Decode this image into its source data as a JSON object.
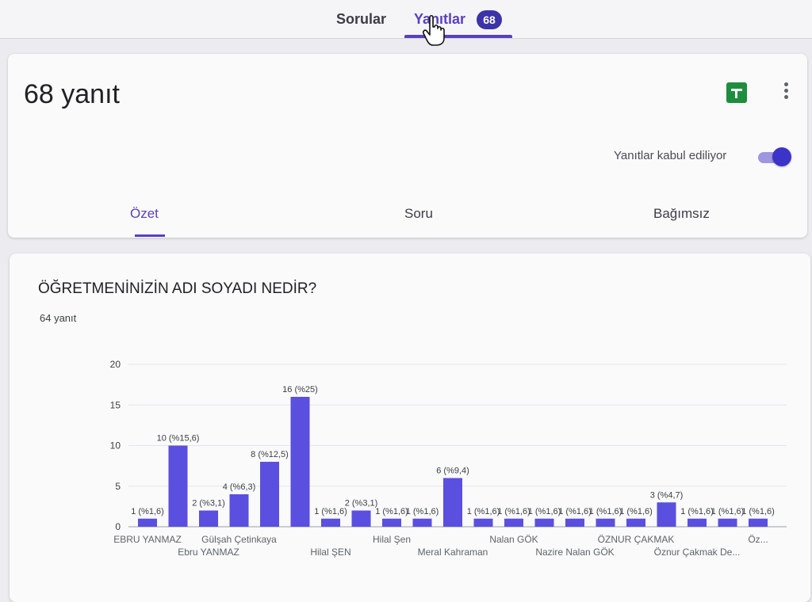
{
  "top_tabs": {
    "questions": "Sorular",
    "responses": "Yanıtlar",
    "responses_badge": "68"
  },
  "header": {
    "title": "68 yanıt",
    "accepting_label": "Yanıtlar kabul ediliyor",
    "accepting_on": true,
    "sheets_icon": "sheets-icon",
    "more_icon": "more-vert-icon"
  },
  "sub_tabs": {
    "summary": "Özet",
    "question": "Soru",
    "individual": "Bağımsız"
  },
  "question": {
    "title": "ÖĞRETMENİNİZİN ADI SOYADI NEDİR?",
    "response_count": "64 yanıt"
  },
  "colors": {
    "accent": "#5a3fc0",
    "bar": "#5b4fe0",
    "toggle": "#3c33c8",
    "sheets": "#1e8e3e"
  },
  "chart_data": {
    "type": "bar",
    "ylim": [
      0,
      20
    ],
    "yticks": [
      "0",
      "5",
      "10",
      "15",
      "20"
    ],
    "values": [
      1,
      10,
      2,
      4,
      8,
      16,
      1,
      2,
      1,
      1,
      6,
      1,
      1,
      1,
      1,
      1,
      1,
      3,
      1,
      1,
      1
    ],
    "data_labels": [
      "1 (%1,6)",
      "10 (%15,6)",
      "2 (%3,1)",
      "4 (%6,3)",
      "8 (%12,5)",
      "16 (%25)",
      "1 (%1,6)",
      "2 (%3,1)",
      "1 (%1,6)",
      "1 (%1,6)",
      "6 (%9,4)",
      "1 (%1,6)",
      "1 (%1,6)",
      "1 (%1,6)",
      "1 (%1,6)",
      "1 (%1,6)",
      "1 (%1,6)",
      "3 (%4,7)",
      "1 (%1,6)",
      "1 (%1,6)",
      "1 (%1,6)"
    ],
    "category_labels": [
      {
        "text": "EBRU YANMAZ",
        "index": 0,
        "row": 0
      },
      {
        "text": "Ebru YANMAZ",
        "index": 2,
        "row": 1
      },
      {
        "text": "Gülşah Çetinkaya",
        "index": 3,
        "row": 0
      },
      {
        "text": "Hilal ŞEN",
        "index": 6,
        "row": 1
      },
      {
        "text": "Hilal Şen",
        "index": 8,
        "row": 0
      },
      {
        "text": "Meral Kahraman",
        "index": 10,
        "row": 1
      },
      {
        "text": "Nalan GÖK",
        "index": 12,
        "row": 0
      },
      {
        "text": "Nazire Nalan GÖK",
        "index": 14,
        "row": 1
      },
      {
        "text": "ÖZNUR ÇAKMAK",
        "index": 16,
        "row": 0
      },
      {
        "text": "Öznur Çakmak De...",
        "index": 18,
        "row": 1
      },
      {
        "text": "Öz...",
        "index": 20,
        "row": 0
      }
    ]
  }
}
